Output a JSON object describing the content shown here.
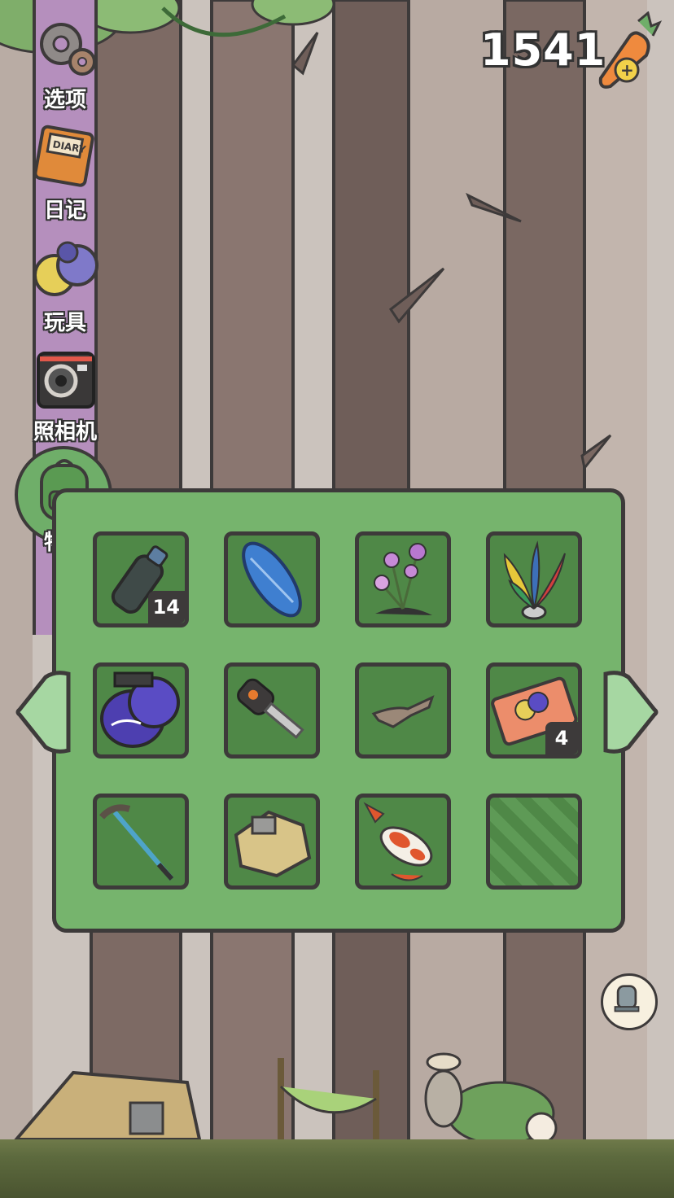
{
  "currency": {
    "clover_count": "1541",
    "icon": "carrot-plus-icon"
  },
  "sidebar": {
    "items": [
      {
        "label": "选项",
        "icon": "gear-icon"
      },
      {
        "label": "日记",
        "icon": "diary-icon"
      },
      {
        "label": "玩具",
        "icon": "toys-icon"
      },
      {
        "label": "照相机",
        "icon": "camera-icon"
      },
      {
        "label": "物品",
        "icon": "backpack-icon",
        "active": true
      }
    ]
  },
  "inventory": {
    "slots": [
      {
        "item": "plastic-bottle",
        "count": "14"
      },
      {
        "item": "surfboard",
        "count": ""
      },
      {
        "item": "orchid-flowers",
        "count": ""
      },
      {
        "item": "feather-shuttlecock",
        "count": ""
      },
      {
        "item": "boxing-gloves",
        "count": ""
      },
      {
        "item": "car-key",
        "count": ""
      },
      {
        "item": "driftwood",
        "count": ""
      },
      {
        "item": "ticket",
        "count": "4"
      },
      {
        "item": "hiking-pole",
        "count": ""
      },
      {
        "item": "patched-cloth",
        "count": ""
      },
      {
        "item": "koi-fish",
        "count": ""
      },
      {
        "item": "empty",
        "count": ""
      }
    ],
    "prev_icon": "arrow-left-icon",
    "next_icon": "arrow-right-icon"
  },
  "scene": {
    "photo_button_icon": "tombstone-photo-icon"
  },
  "colors": {
    "panel": "#76b46d",
    "slot": "#4f8847",
    "outline": "#3d3a3a",
    "sidebar": "#b58fbd"
  }
}
